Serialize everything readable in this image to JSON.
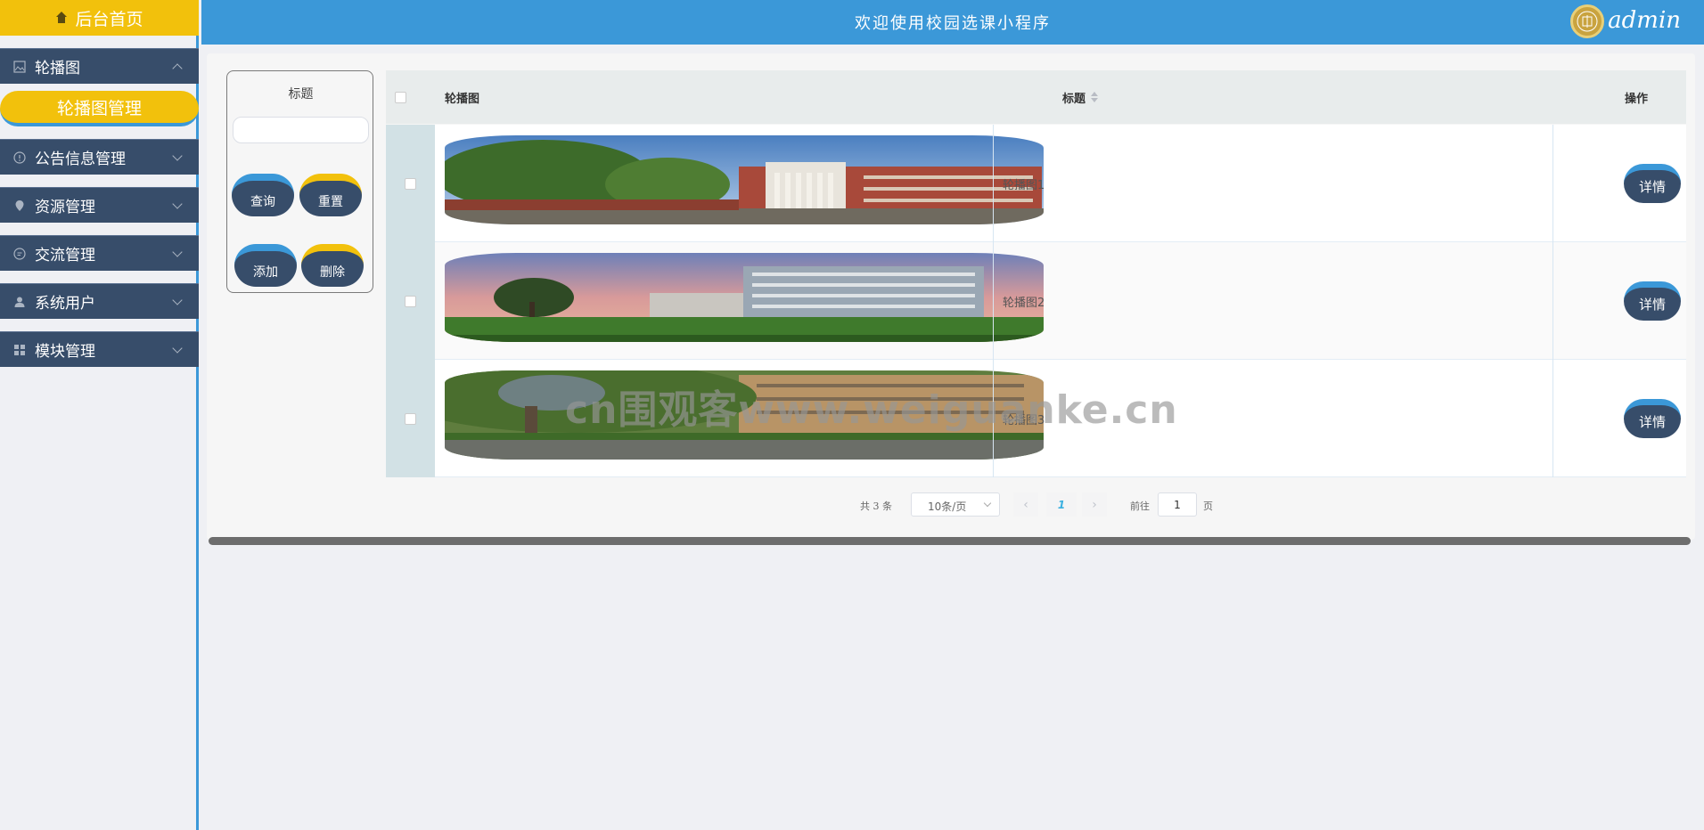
{
  "sidebar": {
    "home_label": "后台首页",
    "items": [
      {
        "label": "轮播图",
        "icon": "image-icon",
        "expanded": true
      },
      {
        "label": "公告信息管理",
        "icon": "info-icon"
      },
      {
        "label": "资源管理",
        "icon": "location-icon"
      },
      {
        "label": "交流管理",
        "icon": "chat-icon"
      },
      {
        "label": "系统用户",
        "icon": "user-icon"
      },
      {
        "label": "模块管理",
        "icon": "grid-icon"
      }
    ],
    "active_sub": "轮播图管理"
  },
  "header": {
    "title": "欢迎使用校园选课小程序",
    "user": "admin"
  },
  "search": {
    "label": "标题",
    "query_btn": "查询",
    "reset_btn": "重置",
    "add_btn": "添加",
    "delete_btn": "删除"
  },
  "table": {
    "columns": [
      "轮播图",
      "标题",
      "操作"
    ],
    "rows": [
      {
        "title": "轮播图1",
        "action": "详情"
      },
      {
        "title": "轮播图2",
        "action": "详情"
      },
      {
        "title": "轮播图3",
        "action": "详情"
      }
    ]
  },
  "pagination": {
    "total": "共 3 条",
    "page_size": "10条/页",
    "current": "1",
    "goto_label": "前往",
    "goto_value": "1",
    "page_suffix": "页"
  },
  "watermark": "cn围观客www.weiguanke.cn",
  "colors": {
    "accent_blue": "#3b98d8",
    "accent_yellow": "#f2c10c",
    "navy": "#374d6a"
  }
}
